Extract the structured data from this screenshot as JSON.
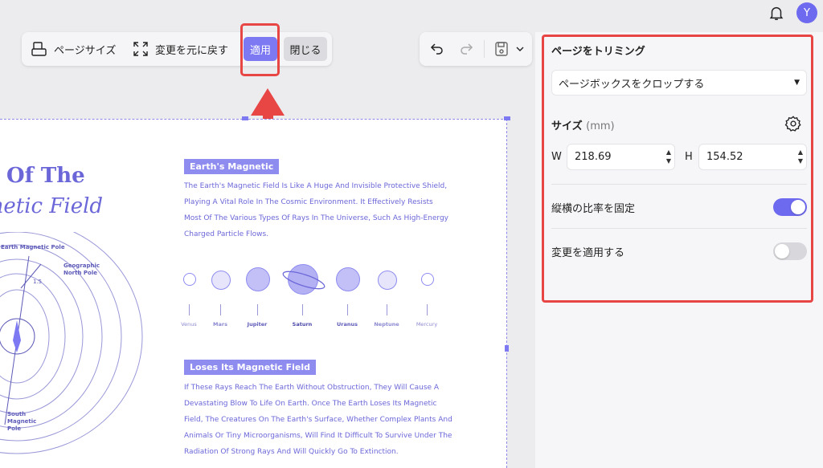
{
  "header": {
    "avatar_initial": "Y"
  },
  "toolbar": {
    "page_size_label": "ページサイズ",
    "revert_label": "変更を元に戻す",
    "apply_label": "適用",
    "close_label": "閉じる"
  },
  "document": {
    "title_line1": "Of The",
    "title_line2": "gnetic Field",
    "section1_tag": "Earth's Magnetic",
    "section1_body": "The Earth's Magnetic Field Is Like A Huge And Invisible Protective Shield, Playing A Vital Role In The Cosmic Environment. It Effectively Resists Most Of The Various Types Of Rays In The Universe, Such As High-Energy Charged Particle Flows.",
    "planets": [
      "Venus",
      "Mars",
      "Jupiter",
      "Saturn",
      "Uranus",
      "Neptune",
      "Mercury"
    ],
    "section2_tag": "Loses Its Magnetic Field",
    "section2_body": "If These Rays Reach The Earth Without Obstruction, They Will Cause A Devastating Blow To Life On Earth. Once The Earth Loses Its Magnetic Field, The Creatures On The Earth's Surface, Whether Complex Plants And Animals Or Tiny Microorganisms, Will Find It Difficult To Survive Under The Radiation Of Strong Rays And Will Quickly Go To Extinction.",
    "north_pole_label": "Geographic North Pole",
    "south_pole_label": "South Magnetic Pole",
    "axis_label_top": "Earth Magnetic Pole",
    "angle_label": "1.5"
  },
  "panel": {
    "title": "ページをトリミング",
    "dropdown_value": "ページボックスをクロップする",
    "size_label": "サイズ",
    "size_unit": "(mm)",
    "w_label": "W",
    "w_value": "218.69",
    "h_label": "H",
    "h_value": "154.52",
    "lock_ratio_label": "縦横の比率を固定",
    "lock_ratio_on": true,
    "apply_changes_label": "変更を適用する",
    "apply_changes_on": false
  },
  "colors": {
    "accent": "#7c79f2",
    "highlight": "#e84545",
    "doc_text": "#6b67d8"
  }
}
